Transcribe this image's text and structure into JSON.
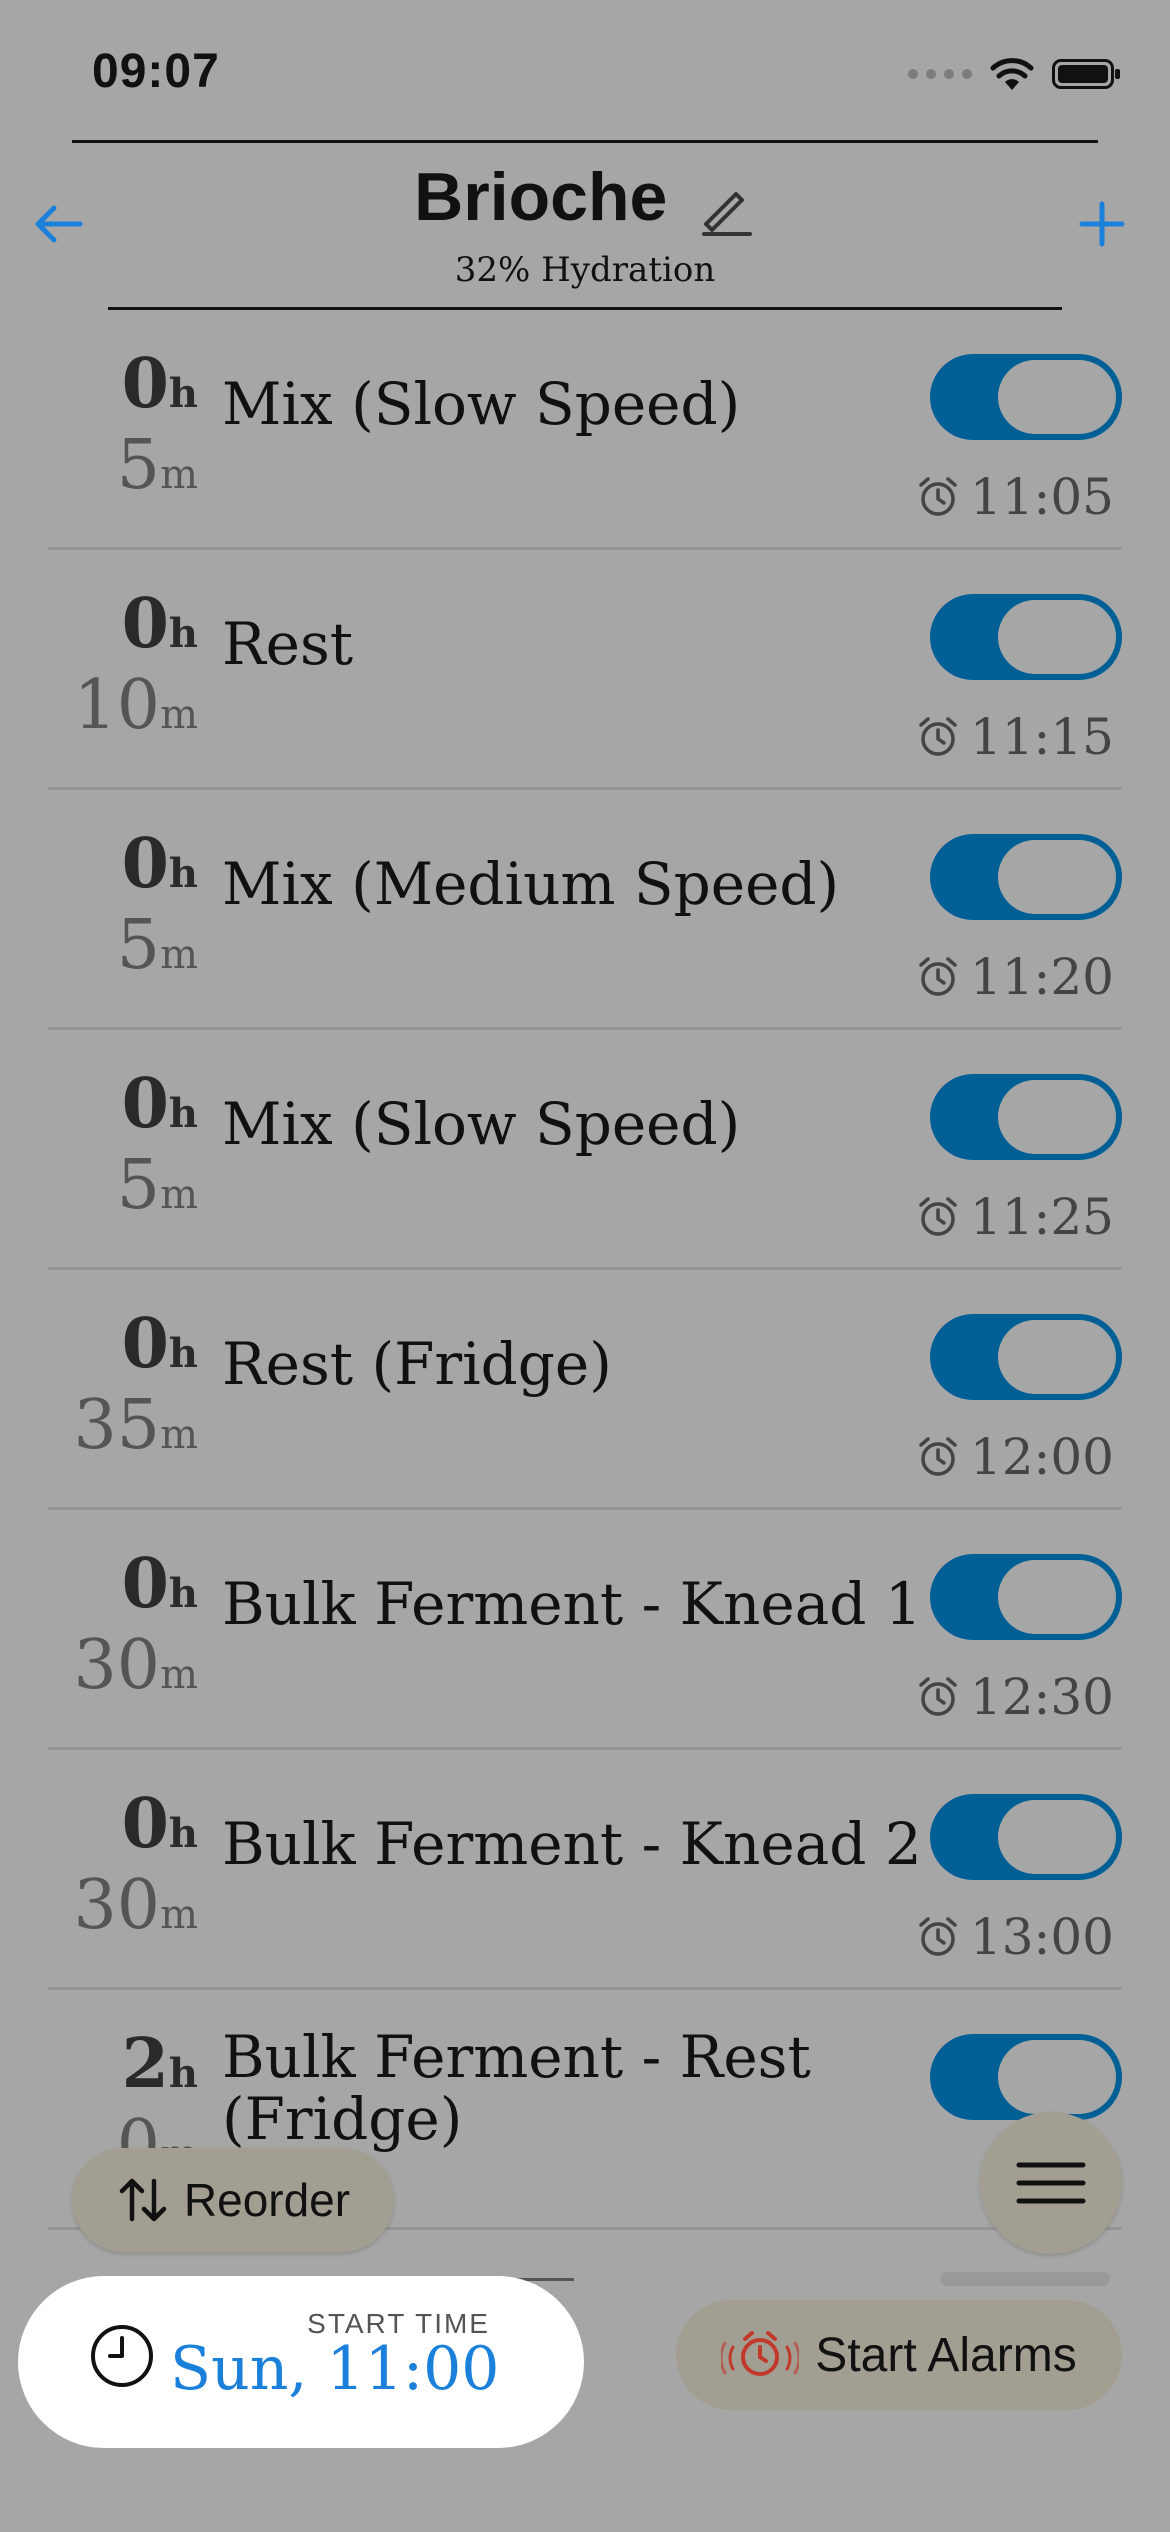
{
  "status": {
    "time": "09:07"
  },
  "header": {
    "title": "Brioche",
    "subtitle": "32% Hydration"
  },
  "units": {
    "hours": "h",
    "minutes": "m"
  },
  "steps": [
    {
      "hours": "0",
      "minutes": "5",
      "name": "Mix (Slow Speed)",
      "enabled": true,
      "alarm_time": "11:05"
    },
    {
      "hours": "0",
      "minutes": "10",
      "name": "Rest",
      "enabled": true,
      "alarm_time": "11:15"
    },
    {
      "hours": "0",
      "minutes": "5",
      "name": "Mix (Medium Speed)",
      "enabled": true,
      "alarm_time": "11:20"
    },
    {
      "hours": "0",
      "minutes": "5",
      "name": "Mix (Slow Speed)",
      "enabled": true,
      "alarm_time": "11:25"
    },
    {
      "hours": "0",
      "minutes": "35",
      "name": "Rest (Fridge)",
      "enabled": true,
      "alarm_time": "12:00"
    },
    {
      "hours": "0",
      "minutes": "30",
      "name": "Bulk Ferment - Knead 1",
      "enabled": true,
      "alarm_time": "12:30"
    },
    {
      "hours": "0",
      "minutes": "30",
      "name": "Bulk Ferment - Knead 2",
      "enabled": true,
      "alarm_time": "13:00"
    },
    {
      "hours": "2",
      "minutes": "0",
      "name": "Bulk Ferment - Rest (Fridge)",
      "enabled": true,
      "alarm_time": ""
    }
  ],
  "controls": {
    "reorder_label": "Reorder",
    "start_time_label": "START TIME",
    "start_time_value": "Sun, 11:00",
    "start_alarms_label": "Start Alarms"
  },
  "colors": {
    "accent": "#1a80d9",
    "toggle_on": "#006096",
    "alarm_icon": "#c0392b"
  }
}
